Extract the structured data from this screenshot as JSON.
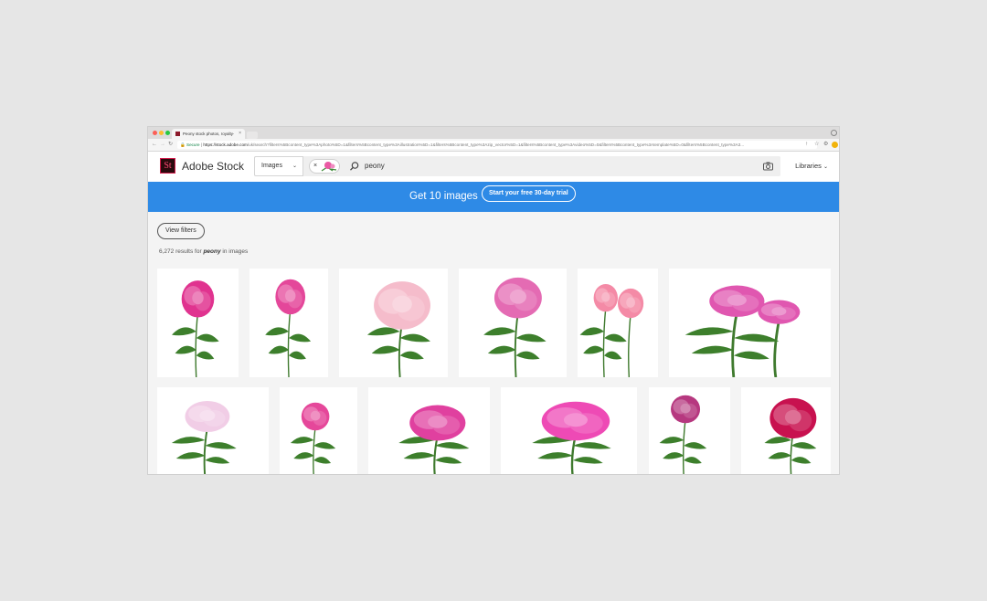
{
  "browser": {
    "tab_title": "Peony stock photos, royalty-fr",
    "tab_close": "×",
    "secure_label": "Secure",
    "url_host": "https://stock.adobe.com",
    "url_path": "/uk/search?filters%5Bcontent_type%3Aphoto%5D=1&filters%5Bcontent_type%3Aillustration%5D=1&filters%5Bcontent_type%3Azip_vector%5D=1&filters%5Bcontent_type%3Avideo%5D=0&filters%5Bcontent_type%3Atemplate%5D=0&filters%5Bcontent_type%3A3..."
  },
  "header": {
    "logo_text": "St",
    "brand": "Adobe Stock",
    "content_type": "Images",
    "query": "peony",
    "libraries": "Libraries"
  },
  "banner": {
    "promo": "Get 10 images",
    "trial_button": "Start your free 30-day trial"
  },
  "results": {
    "filters_button": "View filters",
    "count": "6,272",
    "prefix": "results for",
    "term": "peony",
    "suffix": "in images"
  },
  "images": [
    {
      "alt": "pink peony on stem",
      "color": "#e0338f"
    },
    {
      "alt": "pink peony with leaves",
      "color": "#e4479a"
    },
    {
      "alt": "pale pink peony",
      "color": "#f5bccb"
    },
    {
      "alt": "pink peony with bud",
      "color": "#e46bb3"
    },
    {
      "alt": "two pink peonies",
      "color": "#f48aa6"
    },
    {
      "alt": "pink peony bouquet",
      "color": "#e057b0"
    },
    {
      "alt": "light pink peony",
      "color": "#f1cde6"
    },
    {
      "alt": "pink peony single",
      "color": "#e5479a"
    },
    {
      "alt": "bright pink peony",
      "color": "#e0409f"
    },
    {
      "alt": "magenta peony",
      "color": "#ee4ab5"
    },
    {
      "alt": "purple peony",
      "color": "#b6387f"
    },
    {
      "alt": "crimson peony",
      "color": "#c8114f"
    }
  ],
  "colors": {
    "banner": "#2e8ae6",
    "brand_logo_bg": "#2a0a0d",
    "brand_logo_fg": "#ff4a76"
  }
}
